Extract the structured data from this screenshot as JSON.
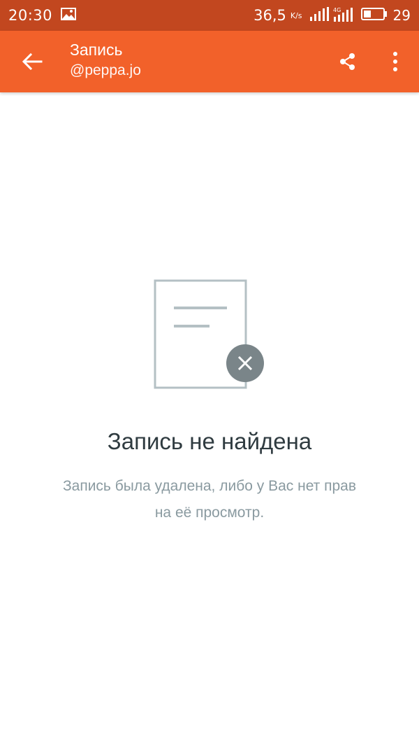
{
  "status_bar": {
    "time": "20:30",
    "network_speed": "36,5",
    "network_unit": "K/s",
    "network_type": "4G",
    "battery_level": "29",
    "icons": [
      "image-icon",
      "signal-icon",
      "signal-4g-icon",
      "battery-icon"
    ]
  },
  "app_bar": {
    "title": "Запись",
    "subtitle": "@peppa.jo",
    "icons": [
      "back-arrow-icon",
      "share-icon",
      "more-vert-icon"
    ]
  },
  "empty_state": {
    "title": "Запись не найдена",
    "description": "Запись была удалена, либо у Вас нет прав на её просмотр.",
    "icons": [
      "document-icon",
      "close-icon"
    ]
  },
  "colors": {
    "status_bar": "#c2471f",
    "app_bar": "#f2612a",
    "title_text": "#2f3b40",
    "description_text": "#8a9aa0",
    "illustration_stroke": "#b4c0c4",
    "badge": "#7a8589"
  }
}
